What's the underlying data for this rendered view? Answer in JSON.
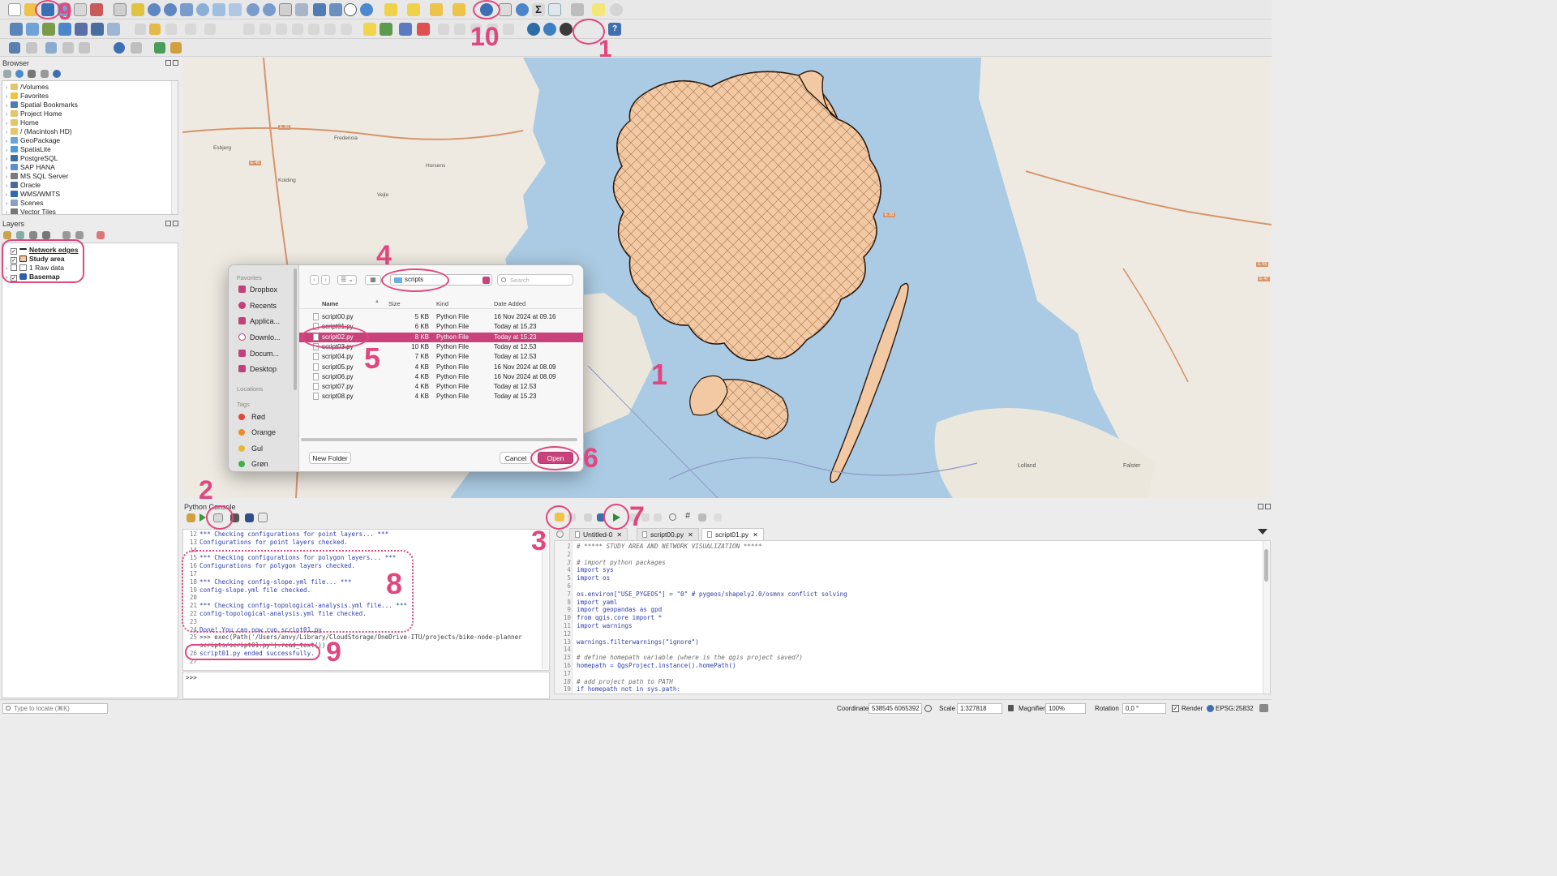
{
  "browser": {
    "title": "Browser",
    "items": [
      {
        "label": "/Volumes",
        "icon": "folder-icon"
      },
      {
        "label": "Favorites",
        "icon": "star-icon"
      },
      {
        "label": "Spatial Bookmarks",
        "icon": "bookmark-icon"
      },
      {
        "label": "Project Home",
        "icon": "folder-icon"
      },
      {
        "label": "Home",
        "icon": "folder-icon"
      },
      {
        "label": "/ (Macintosh HD)",
        "icon": "folder-icon"
      },
      {
        "label": "GeoPackage",
        "icon": "geopackage-icon"
      },
      {
        "label": "SpatiaLite",
        "icon": "spatialite-icon"
      },
      {
        "label": "PostgreSQL",
        "icon": "postgresql-icon"
      },
      {
        "label": "SAP HANA",
        "icon": "saphana-icon"
      },
      {
        "label": "MS SQL Server",
        "icon": "mssql-icon"
      },
      {
        "label": "Oracle",
        "icon": "oracle-icon"
      },
      {
        "label": "WMS/WMTS",
        "icon": "wms-icon"
      },
      {
        "label": "Scenes",
        "icon": "scenes-icon"
      },
      {
        "label": "Vector Tiles",
        "icon": "vector-tiles-icon"
      }
    ]
  },
  "layers": {
    "title": "Layers",
    "items": [
      {
        "label": "Network edges",
        "checked": true
      },
      {
        "label": "Study area",
        "checked": true
      },
      {
        "label": "1 Raw data",
        "checked": false
      },
      {
        "label": "Basemap",
        "checked": true
      }
    ]
  },
  "dialog": {
    "sidebar": {
      "favorites_header": "Favorites",
      "favorites": [
        "Dropbox",
        "Recents",
        "Applica...",
        "Downlo...",
        "Docum...",
        "Desktop"
      ],
      "locations_header": "Locations",
      "tags_header": "Tags",
      "tags": [
        {
          "label": "Rød",
          "color": "#e0473a"
        },
        {
          "label": "Orange",
          "color": "#f08a24"
        },
        {
          "label": "Gul",
          "color": "#e6b82e"
        },
        {
          "label": "Grøn",
          "color": "#3bb34a"
        }
      ]
    },
    "folder": "scripts",
    "search_placeholder": "Search",
    "columns": {
      "name": "Name",
      "size": "Size",
      "kind": "Kind",
      "date": "Date Added"
    },
    "files": [
      {
        "name": "script00.py",
        "size": "5 KB",
        "kind": "Python File",
        "date": "16 Nov 2024 at 09.16"
      },
      {
        "name": "script01.py",
        "size": "6 KB",
        "kind": "Python File",
        "date": "Today at 15.23"
      },
      {
        "name": "script02.py",
        "size": "8 KB",
        "kind": "Python File",
        "date": "Today at 15.23"
      },
      {
        "name": "script03.py",
        "size": "10 KB",
        "kind": "Python File",
        "date": "Today at 12.53"
      },
      {
        "name": "script04.py",
        "size": "7 KB",
        "kind": "Python File",
        "date": "Today at 12.53"
      },
      {
        "name": "script05.py",
        "size": "4 KB",
        "kind": "Python File",
        "date": "16 Nov 2024 at 08.09"
      },
      {
        "name": "script06.py",
        "size": "4 KB",
        "kind": "Python File",
        "date": "16 Nov 2024 at 08.09"
      },
      {
        "name": "script07.py",
        "size": "4 KB",
        "kind": "Python File",
        "date": "Today at 12.53"
      },
      {
        "name": "script08.py",
        "size": "4 KB",
        "kind": "Python File",
        "date": "Today at 15.23"
      }
    ],
    "selected_index": 2,
    "new_folder_label": "New Folder",
    "cancel_label": "Cancel",
    "open_label": "Open"
  },
  "console": {
    "title": "Python Console",
    "prompt": ">>>",
    "lines": [
      {
        "n": "12",
        "text": "*** Checking configurations for point layers... ***"
      },
      {
        "n": "13",
        "text": "Configurations for point layers checked."
      },
      {
        "n": "14",
        "text": ""
      },
      {
        "n": "15",
        "text": "*** Checking configurations for polygon layers... ***"
      },
      {
        "n": "16",
        "text": "Configurations for polygon layers checked."
      },
      {
        "n": "17",
        "text": ""
      },
      {
        "n": "18",
        "text": "*** Checking config-slope.yml file... ***"
      },
      {
        "n": "19",
        "text": "config-slope.yml file checked."
      },
      {
        "n": "20",
        "text": ""
      },
      {
        "n": "21",
        "text": "*** Checking config-topological-analysis.yml file... ***"
      },
      {
        "n": "22",
        "text": "config-topological-analysis.yml file checked."
      },
      {
        "n": "23",
        "text": ""
      },
      {
        "n": "24",
        "text": "Done! You can now run script01.py."
      },
      {
        "n": "25",
        "text": ">>> exec(Path('/Users/anvy/Library/CloudStorage/OneDrive-ITU/projects/bike-node-planner"
      },
      {
        "n": "",
        "text": "scripts/script01.py').read_text())"
      },
      {
        "n": "26",
        "text": "script01.py ended successfully."
      },
      {
        "n": "27",
        "text": ""
      }
    ]
  },
  "editor": {
    "tabs": [
      "Untitled-0",
      "script00.py",
      "script01.py"
    ],
    "active_tab": 2,
    "lines": [
      {
        "n": "1",
        "text": "# ***** STUDY AREA AND NETWORK VISUALIZATION *****",
        "comment": true
      },
      {
        "n": "2",
        "text": "",
        "comment": false
      },
      {
        "n": "3",
        "text": "# import python packages",
        "comment": true
      },
      {
        "n": "4",
        "text": "import sys",
        "comment": false
      },
      {
        "n": "5",
        "text": "import os",
        "comment": false
      },
      {
        "n": "6",
        "text": "",
        "comment": false
      },
      {
        "n": "7",
        "text": "os.environ[\"USE_PYGEOS\"] = \"0\"  # pygeos/shapely2.0/osmnx conflict solving",
        "comment": false
      },
      {
        "n": "8",
        "text": "import yaml",
        "comment": false
      },
      {
        "n": "9",
        "text": "import geopandas as gpd",
        "comment": false
      },
      {
        "n": "10",
        "text": "from qgis.core import *",
        "comment": false
      },
      {
        "n": "11",
        "text": "import warnings",
        "comment": false
      },
      {
        "n": "12",
        "text": "",
        "comment": false
      },
      {
        "n": "13",
        "text": "warnings.filterwarnings(\"ignore\")",
        "comment": false
      },
      {
        "n": "14",
        "text": "",
        "comment": false
      },
      {
        "n": "15",
        "text": "# define homepath variable (where is the qgis project saved?)",
        "comment": true
      },
      {
        "n": "16",
        "text": "homepath = QgsProject.instance().homePath()",
        "comment": false
      },
      {
        "n": "17",
        "text": "",
        "comment": false
      },
      {
        "n": "18",
        "text": "# add project path to PATH",
        "comment": true
      },
      {
        "n": "19",
        "text": "if homepath not in sys.path:",
        "comment": false
      }
    ]
  },
  "status": {
    "locate_placeholder": "Type to locate (⌘K)",
    "coordinate_label": "Coordinate",
    "coordinate_value": "538545  6065392",
    "scale_label": "Scale",
    "scale_value": "1:327818",
    "magnifier_label": "Magnifier",
    "magnifier_value": "100%",
    "rotation_label": "Rotation",
    "rotation_value": "0,0 °",
    "render_label": "Render",
    "crs_label": "EPSG:25832"
  },
  "map_labels": {
    "places": [
      "Esbjerg",
      "Kolding",
      "Fredericia",
      "Vejle",
      "Horsens",
      "Lolland",
      "Falster"
    ],
    "roads": [
      "E 45",
      "E 20",
      "E 20",
      "E 47",
      "E 55"
    ]
  },
  "annotations": [
    "1",
    "1",
    "2",
    "3",
    "4",
    "5",
    "6",
    "7",
    "8",
    "9",
    "9",
    "10"
  ],
  "colors": {
    "accent": "#e0477e",
    "selection": "#c9427c",
    "polygon_fill": "#f2c9a2",
    "water": "#aacbe3",
    "land": "#eeeae2"
  }
}
